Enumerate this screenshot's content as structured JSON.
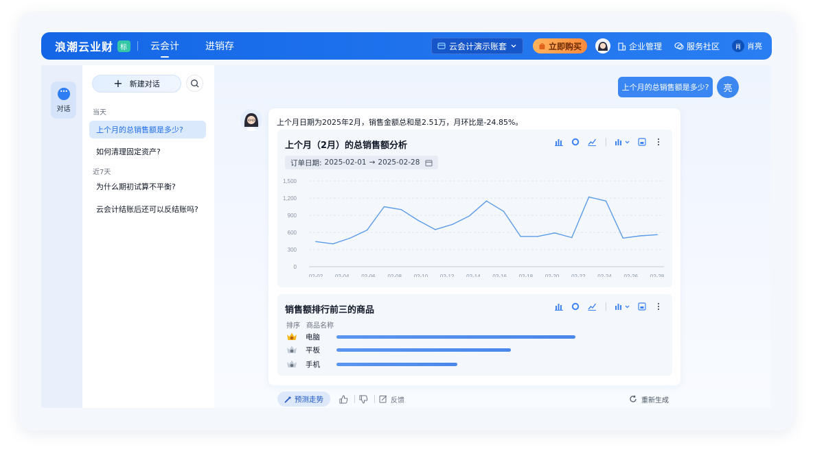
{
  "header": {
    "brand": "浪潮云业财",
    "brand_badge": "标",
    "tabs": [
      {
        "label": "云会计",
        "active": true
      },
      {
        "label": "进销存",
        "active": false
      }
    ],
    "account_select": "云会计演示账套",
    "buy_button": "立即购买",
    "links": [
      "企业管理",
      "服务社区"
    ],
    "user_initial": "肖",
    "user_name": "肖亮"
  },
  "rail": {
    "items": [
      {
        "label": "对话",
        "icon": "chat-icon",
        "active": true
      }
    ]
  },
  "sidebar": {
    "new_chat_label": "新建对话",
    "groups": [
      {
        "label": "当天",
        "items": [
          {
            "label": "上个月的总销售额是多少?",
            "active": true
          },
          {
            "label": "如何清理固定资产?",
            "active": false
          }
        ]
      },
      {
        "label": "近7天",
        "items": [
          {
            "label": "为什么期初试算不平衡?",
            "active": false
          },
          {
            "label": "云会计结账后还可以反结账吗?",
            "active": false
          }
        ]
      }
    ]
  },
  "conversation": {
    "user_question": "上个月的总销售额是多少?",
    "user_avatar_text": "亮",
    "answer_text": "上个月日期为2025年2月，销售金额总和是2.51万，月环比是-24.85%。"
  },
  "trend_panel": {
    "title": "上个月（2月）的总销售额分析",
    "filter_label": "订单日期:",
    "date_from": "2025-02-01",
    "date_arrow": "→",
    "date_to": "2025-02-28"
  },
  "ranking_panel": {
    "title": "销售额排行前三的商品",
    "col_rank": "排序",
    "col_name": "商品名称",
    "medal_colors": [
      "#f5b81c",
      "#b8c2cf",
      "#b8c2cf"
    ],
    "rows": [
      {
        "rank": 1,
        "name": "电脑",
        "share": 0.81
      },
      {
        "rank": 2,
        "name": "平板",
        "share": 0.59
      },
      {
        "rank": 3,
        "name": "手机",
        "share": 0.41
      }
    ]
  },
  "footer": {
    "predict_label": "预测走势",
    "feedback_label": "反馈",
    "regenerate_label": "重新生成"
  },
  "colors": {
    "brand": "#1466e6",
    "accent": "#3a86f2",
    "line": "#5b9be8"
  },
  "chart_data": {
    "type": "line",
    "title": "上个月（2月）的总销售额分析",
    "xlabel": "",
    "ylabel": "",
    "x": [
      "02-02",
      "02-03",
      "02-04",
      "02-05",
      "02-06",
      "02-07",
      "02-08",
      "02-09",
      "02-10",
      "02-11",
      "02-12",
      "02-13",
      "02-14",
      "02-15",
      "02-16",
      "02-17",
      "02-18",
      "02-19",
      "02-20",
      "02-21",
      "02-22",
      "02-23",
      "02-24",
      "02-25",
      "02-26",
      "02-27",
      "02-28"
    ],
    "x_tick_labels": [
      "02-02",
      "02-04",
      "02-06",
      "02-08",
      "02-10",
      "02-12",
      "02-14",
      "02-16",
      "02-18",
      "02-20",
      "02-22",
      "02-24",
      "02-26",
      "02-28"
    ],
    "series": [
      {
        "values": [
          440,
          400,
          500,
          640,
          1050,
          1000,
          810,
          650,
          740,
          890,
          1150,
          970,
          530,
          530,
          590,
          510,
          1220,
          1150,
          500,
          540,
          560
        ]
      }
    ],
    "series_x_index": [
      0,
      2,
      4,
      6,
      8,
      10,
      12,
      14,
      16,
      18,
      20,
      22,
      24,
      26,
      28,
      30,
      32,
      34,
      36,
      38,
      40
    ],
    "y_ticks": [
      "0",
      "300",
      "600",
      "900",
      "1,200",
      "1,500"
    ],
    "ylim": [
      0,
      1500
    ],
    "grid": true
  }
}
